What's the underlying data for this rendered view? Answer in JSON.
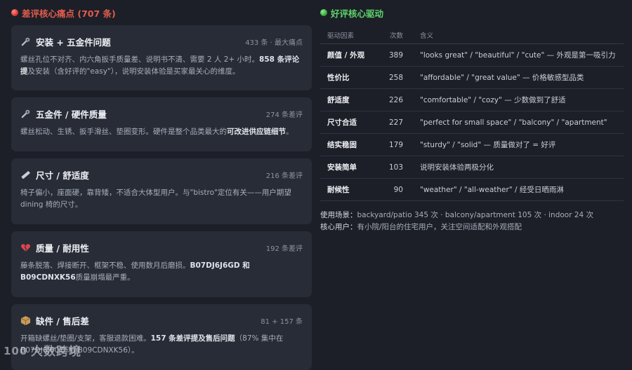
{
  "negative": {
    "title": "差评核心痛点 (707 条)",
    "cards": [
      {
        "icon": "wrench-bolt-icon",
        "title": "安装 + 五金件问题",
        "meta": "433 条 · 最大痛点",
        "body_a": "螺丝孔位不对齐、内六角扳手质量差、说明书不清、需要 2 人 2+ 小时。",
        "body_b": "858 条评论提",
        "body_c": "及安装（含好评的\"easy\"），说明安装体验是买家最关心的维度。"
      },
      {
        "icon": "wrench-bolt-icon",
        "title": "五金件 / 硬件质量",
        "meta": "274 条差评",
        "body_a": "螺丝松动、生锈、扳手滑丝、垫圈变形。硬件是整个品类最大的",
        "body_b": "可改进供应链细节",
        "body_c": "。"
      },
      {
        "icon": "ruler-icon",
        "title": "尺寸 / 舒适度",
        "meta": "216 条差评",
        "body_a": "椅子偏小，座面硬，靠背矮，不适合大体型用户。与\"bistro\"定位有关——用户期望 dining 椅的尺寸。",
        "body_b": "",
        "body_c": ""
      },
      {
        "icon": "broken-heart-icon",
        "title": "质量 / 耐用性",
        "meta": "192 条差评",
        "body_a": "藤条脱落、焊接断开、框架不稳、使用数月后磨损。",
        "body_b": "B07DJ6J6GD 和 B09CDNXK56",
        "body_c": "质量崩塌最严重。"
      },
      {
        "icon": "package-icon",
        "title": "缺件 / 售后差",
        "meta": "81 + 157 条",
        "body_a": "开箱缺螺丝/垫圈/支架，客服退款困难。",
        "body_b": "157 条差评提及售后问题",
        "body_c": "（87% 集中在 B07DJ6J6GD 和 B09CDNXK56）。"
      }
    ]
  },
  "positive": {
    "title": "好评核心驱动",
    "columns": [
      "驱动因素",
      "次数",
      "含义"
    ],
    "rows": [
      {
        "factor": "颜值 / 外观",
        "count": "389",
        "meaning": "\"looks great\" / \"beautiful\" / \"cute\" — 外观是第一吸引力"
      },
      {
        "factor": "性价比",
        "count": "258",
        "meaning": "\"affordable\" / \"great value\" — 价格敏感型品类"
      },
      {
        "factor": "舒适度",
        "count": "226",
        "meaning": "\"comfortable\" / \"cozy\" — 少数做到了舒适"
      },
      {
        "factor": "尺寸合适",
        "count": "227",
        "meaning": "\"perfect for small space\" / \"balcony\" / \"apartment\""
      },
      {
        "factor": "结实稳固",
        "count": "179",
        "meaning": "\"sturdy\" / \"solid\" — 质量做对了 = 好评"
      },
      {
        "factor": "安装简单",
        "count": "103",
        "meaning": "说明安装体验两极分化"
      },
      {
        "factor": "耐候性",
        "count": "90",
        "meaning": "\"weather\" / \"all-weather\" / 经受日晒雨淋"
      }
    ],
    "scenario_label": "使用场景：",
    "scenario_text": "backyard/patio 345 次 · balcony/apartment 105 次 · indoor 24 次",
    "core_label": "核心用户：",
    "core_text": "有小院/阳台的住宅用户，关注空间适配和外观搭配"
  },
  "watermark": {
    "logo_text": "100",
    "text": "大数跨境"
  },
  "colors": {
    "background": "#1c1f27",
    "card": "#272c37",
    "negative_accent": "#e25b4e",
    "positive_accent": "#5fd36a"
  }
}
